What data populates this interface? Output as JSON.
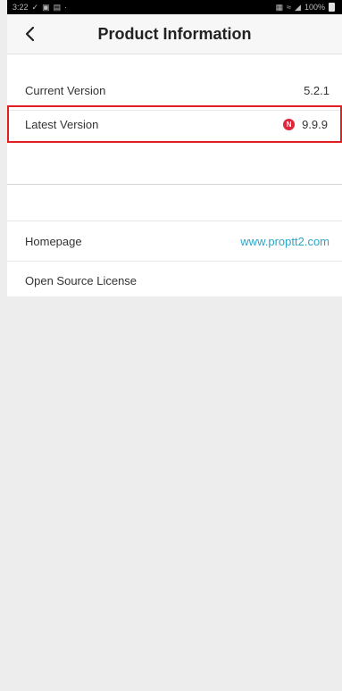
{
  "status_bar": {
    "time": "3:22",
    "left_icons": [
      "check-icon",
      "notification-icon",
      "gallery-icon",
      "dot-icon"
    ],
    "battery": "100%"
  },
  "header": {
    "title": "Product Information",
    "back_icon": "chevron-left-icon"
  },
  "rows": {
    "current_version": {
      "label": "Current Version",
      "value": "5.2.1"
    },
    "latest_version": {
      "label": "Latest Version",
      "badge": "N",
      "value": "9.9.9"
    },
    "homepage": {
      "label": "Homepage",
      "value": "www.proptt2.com"
    },
    "open_source": {
      "label": "Open Source License"
    }
  },
  "colors": {
    "highlight_border": "#e02020",
    "badge": "#e0263a",
    "link": "#2aa6c8"
  }
}
